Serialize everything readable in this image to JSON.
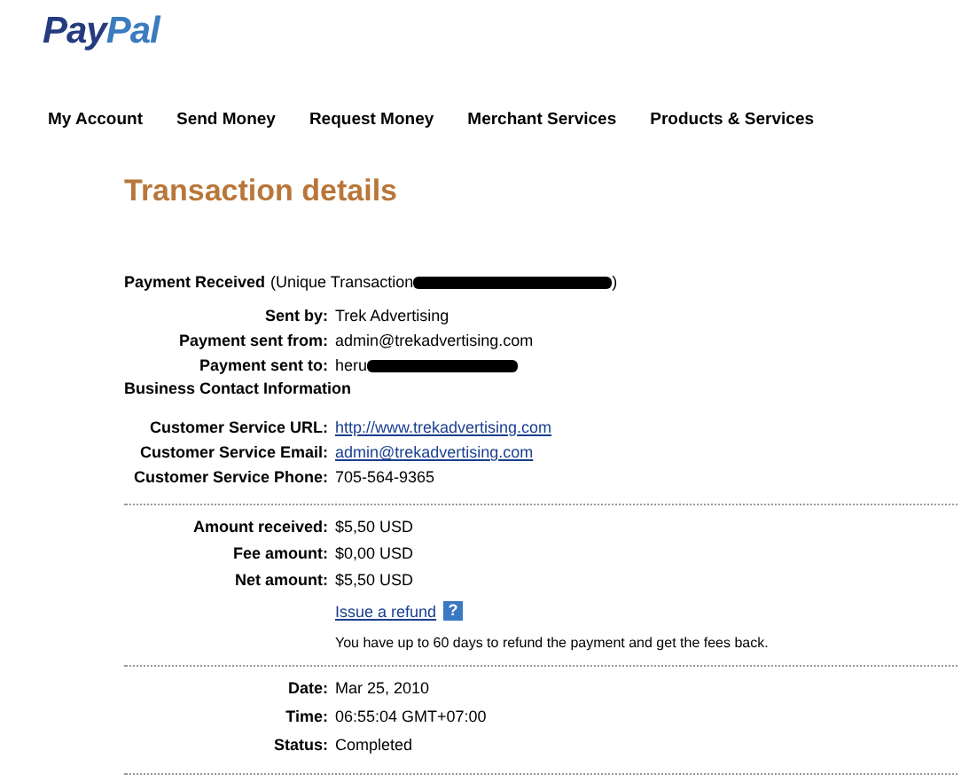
{
  "logo": {
    "first": "Pay",
    "second": "Pal"
  },
  "nav": [
    {
      "label": "My Account"
    },
    {
      "label": "Send Money"
    },
    {
      "label": "Request Money"
    },
    {
      "label": "Merchant Services"
    },
    {
      "label": "Products & Services"
    }
  ],
  "title": "Transaction details",
  "header": {
    "label": "Payment Received",
    "note": "(Unique Transaction",
    "closing": ")",
    "redacted": true
  },
  "sections": [
    {
      "rows": [
        {
          "kind": "field",
          "label": "Sent by:",
          "value": "Trek Advertising"
        },
        {
          "kind": "field",
          "label": "Payment sent from:",
          "value": "admin@trekadvertising.com"
        },
        {
          "kind": "field",
          "label": "Payment sent to:",
          "value": "heru",
          "redacted": true
        },
        {
          "kind": "heading",
          "text": "Business Contact Information"
        },
        {
          "kind": "link",
          "label": "Customer Service URL:",
          "value": "http://www.trekadvertising.com"
        },
        {
          "kind": "link",
          "label": "Customer Service Email:",
          "value": "admin@trekadvertising.com"
        },
        {
          "kind": "field",
          "label": "Customer Service Phone:",
          "value": "705-564-9365"
        }
      ]
    },
    {
      "rows": [
        {
          "kind": "field",
          "label": "Amount received:",
          "value": "$5,50 USD"
        },
        {
          "kind": "field",
          "label": "Fee amount:",
          "value": "$0,00 USD"
        },
        {
          "kind": "field",
          "label": "Net amount:",
          "value": "$5,50 USD"
        },
        {
          "kind": "action",
          "link": "Issue a refund",
          "help": "?"
        },
        {
          "kind": "note",
          "text": "You have up to 60 days to refund the payment and get the fees back."
        }
      ]
    },
    {
      "rows": [
        {
          "kind": "field",
          "label": "Date:",
          "value": "Mar 25, 2010"
        },
        {
          "kind": "field",
          "label": "Time:",
          "value": "06:55:04 GMT+07:00"
        },
        {
          "kind": "field",
          "label": "Status:",
          "value": "Completed"
        }
      ]
    }
  ]
}
